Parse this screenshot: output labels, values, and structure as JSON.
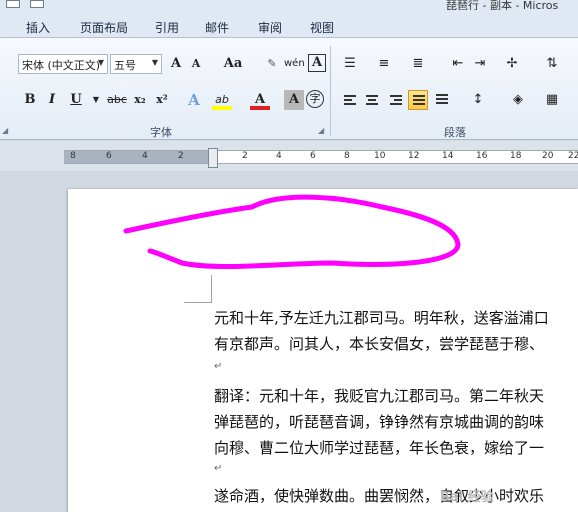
{
  "window": {
    "title": "琵琶行 - 副本 - Micros"
  },
  "tabs": [
    {
      "label": "插入"
    },
    {
      "label": "页面布局"
    },
    {
      "label": "引用"
    },
    {
      "label": "邮件"
    },
    {
      "label": "审阅"
    },
    {
      "label": "视图"
    }
  ],
  "ribbon": {
    "font_name": "宋体 (中文正文)",
    "font_size": "五号",
    "grow_font": "A",
    "shrink_font": "A",
    "change_case": "Aa",
    "pinyin": "wén",
    "char_border": "A",
    "bold": "B",
    "italic": "I",
    "underline": "U",
    "strikethrough": "abc",
    "subscript": "x₂",
    "superscript": "x²",
    "text_effect": "A",
    "highlight": "ab",
    "font_color": "A",
    "char_shading": "A",
    "enclose_char": "字",
    "group_font": "字体",
    "group_paragraph": "段落",
    "colors": {
      "highlight_yellow": "#ffff00",
      "font_red": "#e02020",
      "active_button": "#ffc947"
    }
  },
  "ruler": {
    "numbers": [
      "8",
      "6",
      "4",
      "2",
      "2",
      "4",
      "6",
      "8",
      "10",
      "12",
      "14",
      "16",
      "18",
      "20",
      "22"
    ]
  },
  "document": {
    "lines": [
      "元和十年,予左迁九江郡司马。明年秋，送客溢浦口",
      "有京都声。问其人，本长安倡女，尝学琵琶于穆、",
      "翻译：元和十年，我贬官九江郡司马。第二年秋天",
      "弹琵琶的，听琵琶音调，铮铮然有京城曲调的韵味",
      "向穆、曹二位大师学过琵琶，年长色衰，嫁给了一",
      "遂命酒，使快弹数曲。曲罢悯然，自叙少小时欢乐"
    ],
    "para_mark": "↵"
  },
  "annotation": {
    "color": "#ff00ff"
  },
  "watermark": {
    "text": "Bai 经验"
  }
}
